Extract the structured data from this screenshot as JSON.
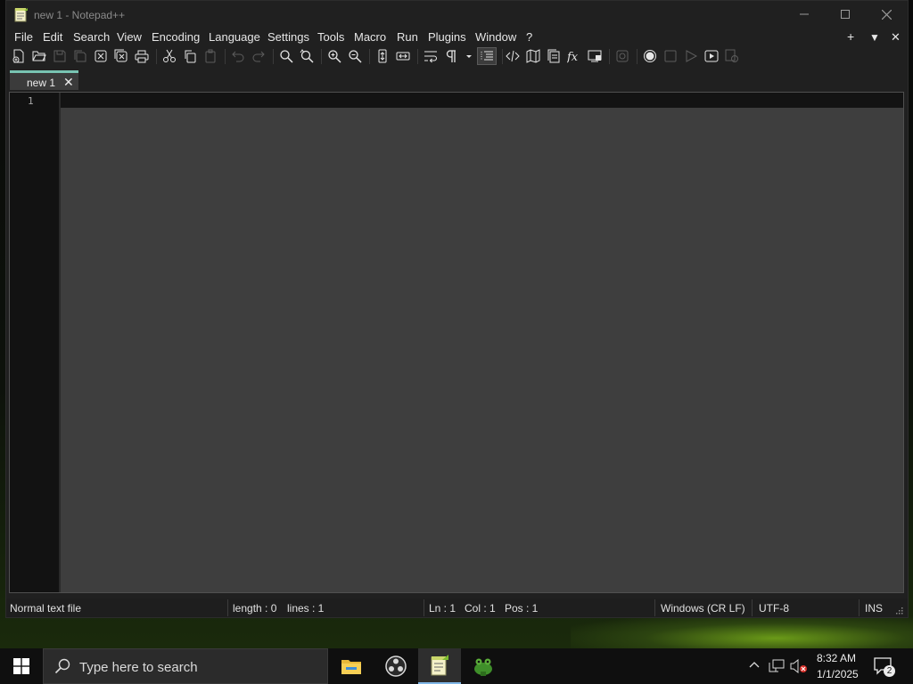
{
  "window": {
    "title": "new 1 - Notepad++",
    "controls": {
      "minimize": "—",
      "maximize": "☐",
      "close": "✕"
    }
  },
  "menu": {
    "items": [
      "File",
      "Edit",
      "Search",
      "View",
      "Encoding",
      "Language",
      "Settings",
      "Tools",
      "Macro",
      "Run",
      "Plugins",
      "Window",
      "?"
    ],
    "right": {
      "add": "+",
      "list": "▼",
      "close": "✕"
    }
  },
  "toolbar": {
    "buttons": [
      "new-file-icon",
      "open-file-icon",
      "save-icon",
      "save-all-icon",
      "close-icon",
      "close-all-icon",
      "print-icon",
      "cut-icon",
      "copy-icon",
      "paste-icon",
      "undo-icon",
      "redo-icon",
      "find-icon",
      "replace-icon",
      "zoom-in-icon",
      "zoom-out-icon",
      "sync-vertical-icon",
      "sync-horizontal-icon",
      "word-wrap-icon",
      "show-all-chars-icon",
      "indent-guide-icon",
      "udl-icon",
      "document-map-icon",
      "document-list-icon",
      "function-list-icon",
      "folder-workspace-icon",
      "monitoring-icon",
      "record-macro-icon",
      "stop-record-icon",
      "playback-icon",
      "run-macro-multiple-icon",
      "save-macro-icon"
    ]
  },
  "tabs": [
    {
      "label": "new 1",
      "close": "✕"
    }
  ],
  "editor": {
    "line_numbers": [
      "1"
    ],
    "content": ""
  },
  "status": {
    "file_type": "Normal text file",
    "length": "length : 0",
    "lines": "lines : 1",
    "ln": "Ln : 1",
    "col": "Col : 1",
    "pos": "Pos : 1",
    "eol": "Windows (CR LF)",
    "encoding": "UTF-8",
    "mode": "INS"
  },
  "taskbar": {
    "search_placeholder": "Type here to search",
    "apps": [
      "file-explorer-icon",
      "obs-studio-icon",
      "notepad-plus-plus-icon",
      "frog-app-icon"
    ],
    "clock_time": "8:32 AM",
    "clock_date": "1/1/2025",
    "notification_count": "2"
  },
  "colors": {
    "accent_tab": "#78c4b2",
    "editor_bg": "#3e3e3e",
    "window_bg": "#202020"
  }
}
